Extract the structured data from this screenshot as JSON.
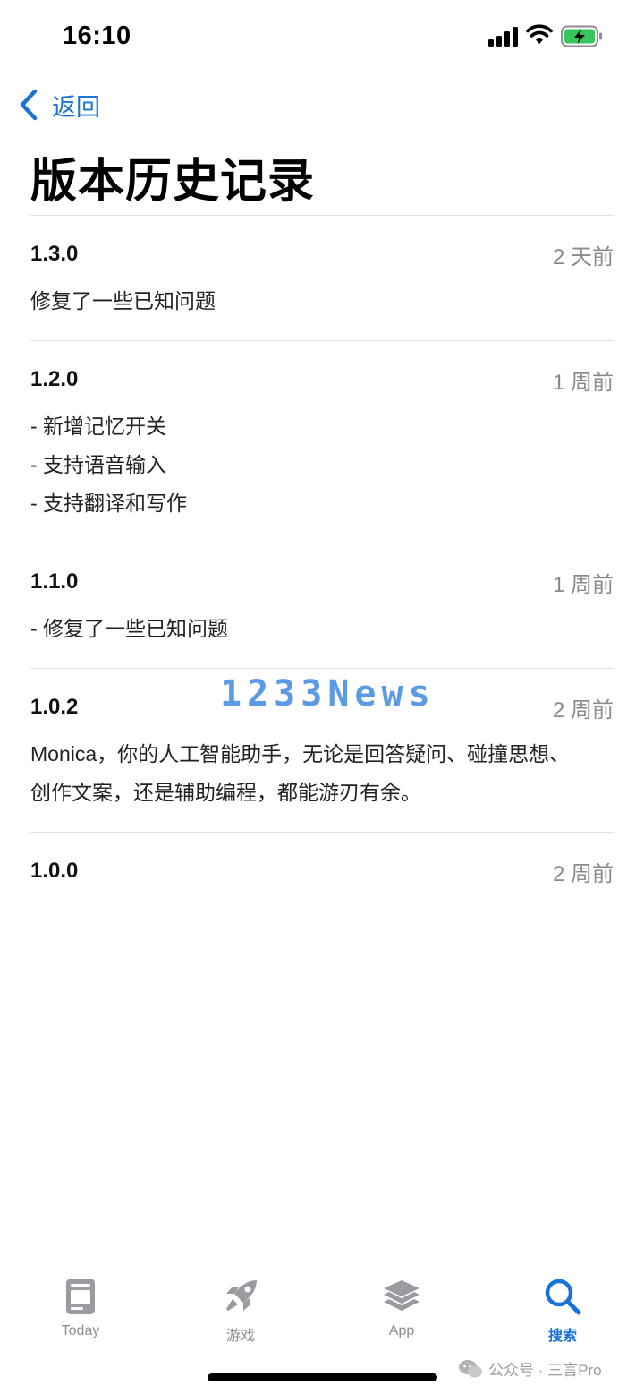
{
  "status_bar": {
    "time": "16:10",
    "icons": [
      "signal-icon",
      "wifi-icon",
      "battery-charging-icon"
    ]
  },
  "nav": {
    "back_label": "返回",
    "back_icon": "chevron-left-icon"
  },
  "page": {
    "title": "版本历史记录"
  },
  "versions": [
    {
      "version": "1.3.0",
      "date": "2 天前",
      "notes": [
        "修复了一些已知问题"
      ]
    },
    {
      "version": "1.2.0",
      "date": "1 周前",
      "notes": [
        "- 新增记忆开关",
        "- 支持语音输入",
        "- 支持翻译和写作"
      ]
    },
    {
      "version": "1.1.0",
      "date": "1 周前",
      "notes": [
        "- 修复了一些已知问题"
      ]
    },
    {
      "version": "1.0.2",
      "date": "2 周前",
      "notes": [
        "Monica，你的人工智能助手，无论是回答疑问、碰撞思想、",
        "创作文案，还是辅助编程，都能游刃有余。"
      ]
    },
    {
      "version": "1.0.0",
      "date": "2 周前",
      "notes": []
    }
  ],
  "watermark": "1233News",
  "tab_bar": {
    "tabs": [
      {
        "label": "Today",
        "icon": "today-icon",
        "active": false
      },
      {
        "label": "游戏",
        "icon": "rocket-icon",
        "active": false
      },
      {
        "label": "App",
        "icon": "app-stack-icon",
        "active": false
      },
      {
        "label": "搜索",
        "icon": "search-icon",
        "active": true
      }
    ]
  },
  "source_credit": {
    "text": "公众号 · 三言Pro",
    "icon": "wechat-icon"
  },
  "colors": {
    "accent": "#1a73d9",
    "secondary_text": "#8a8a8e",
    "divider": "#e2e2e4",
    "watermark": "#4a90e2"
  }
}
